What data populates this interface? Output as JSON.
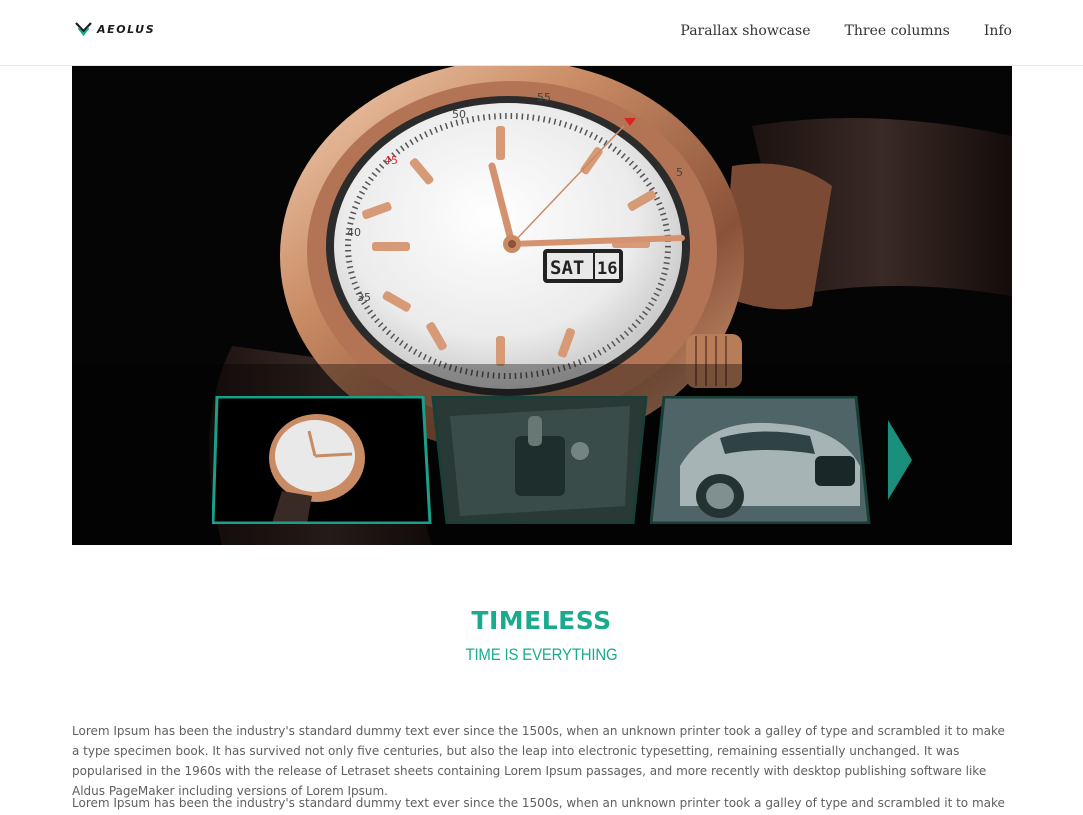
{
  "header": {
    "logo_text": "AEOLUS",
    "nav": [
      {
        "label": "Parallax showcase"
      },
      {
        "label": "Three columns"
      },
      {
        "label": "Info"
      }
    ]
  },
  "hero": {
    "slides": [
      {
        "name": "watch",
        "active": true
      },
      {
        "name": "car interior",
        "active": false
      },
      {
        "name": "car",
        "active": false
      }
    ],
    "watch_date_label": "SAT",
    "watch_day_label": "16",
    "watch_minute_numbers": [
      "55",
      "50",
      "45",
      "40",
      "35",
      "5"
    ]
  },
  "intro": {
    "title": "TIMELESS",
    "subtitle": "TIME IS EVERYTHING"
  },
  "paragraphs": [
    "Lorem Ipsum has been the industry's standard dummy text ever since the 1500s, when an unknown printer took a galley of type and scrambled it to make a type specimen book. It has survived not only five centuries, but also the leap into electronic typesetting, remaining essentially unchanged. It was popularised in the 1960s with the release of Letraset sheets containing Lorem Ipsum passages, and more recently with desktop publishing software like Aldus PageMaker including versions of Lorem Ipsum.",
    "Lorem Ipsum has been the industry's standard dummy text ever since the 1500s, when an unknown printer took a galley of type and scrambled it to make a type specimen"
  ],
  "colors": {
    "accent": "#1aaa8e",
    "hero_bg": "#050505",
    "thumb_border": "#1aa08a"
  }
}
